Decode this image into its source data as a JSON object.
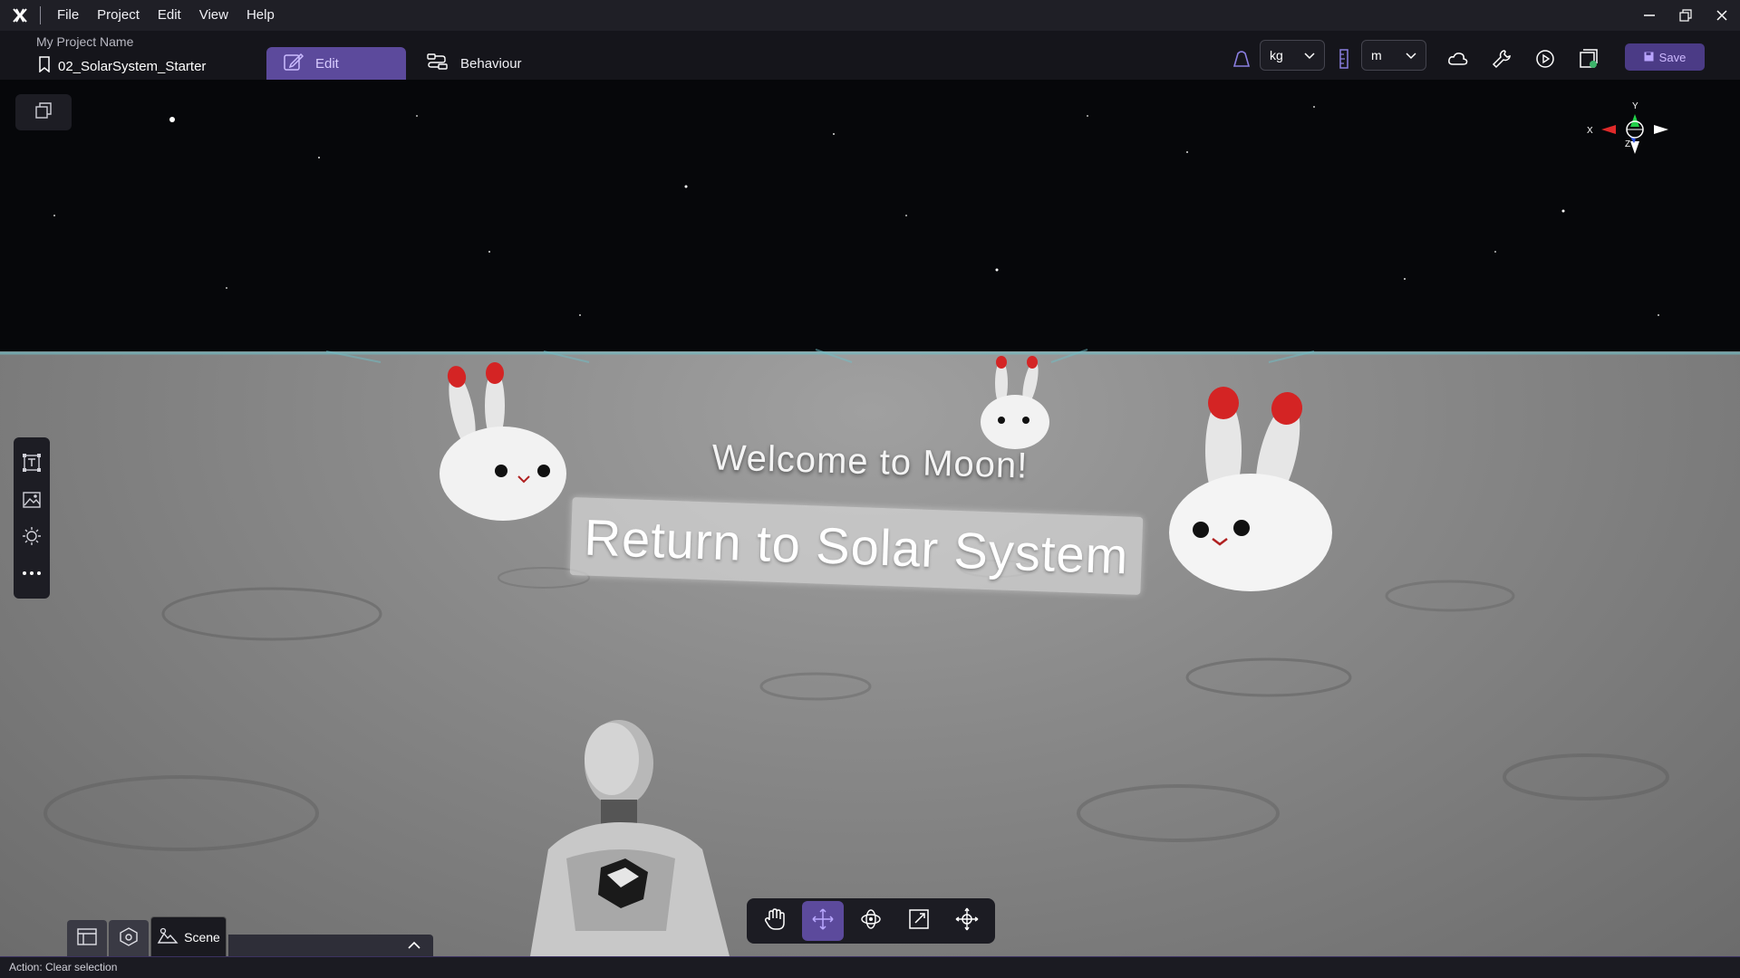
{
  "titlebar": {
    "menu": [
      "File",
      "Project",
      "Edit",
      "View",
      "Help"
    ]
  },
  "project": {
    "name": "My Project Name",
    "scene": "02_SolarSystem_Starter"
  },
  "modes": {
    "edit_label": "Edit",
    "behaviour_label": "Behaviour"
  },
  "units": {
    "mass": "kg",
    "length": "m"
  },
  "toolbar": {
    "save_label": "Save"
  },
  "viewport": {
    "welcome_text": "Welcome to Moon!",
    "return_button": "Return to Solar System",
    "gizmo_axes": {
      "x": "X",
      "y": "Y",
      "z": "Z"
    }
  },
  "bottom_panel": {
    "scene_tab": "Scene"
  },
  "status": {
    "text": "Action: Clear selection"
  },
  "colors": {
    "accent": "#5c4a9c",
    "save_bg": "#4b3b86",
    "rabbit_ear_tip": "#d62020"
  }
}
